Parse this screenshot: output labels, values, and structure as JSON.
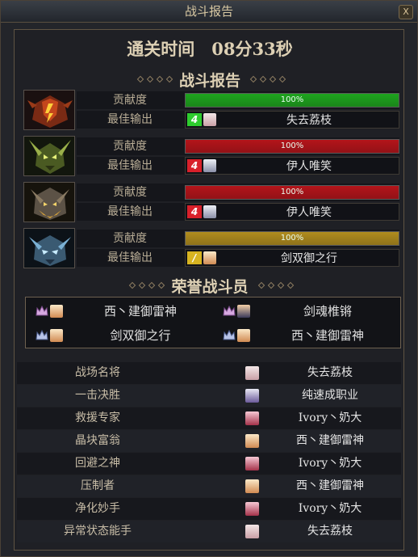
{
  "window": {
    "title": "战斗报告",
    "close_label": "X"
  },
  "clear_time": "通关时间　08分33秒",
  "battle_report": {
    "heading": "战斗报告",
    "contribution_label": "贡献度",
    "best_output_label": "最佳输出",
    "bosses": [
      {
        "icon": "red-demon-boss-icon",
        "contribution": "100%",
        "contribution_fraction": 1.0,
        "bar_color": "#1ea41e",
        "best_level_badge": "4",
        "badge_color": "#2ecc2e",
        "best_output_player": "失去荔枝"
      },
      {
        "icon": "green-horned-boss-icon",
        "contribution": "100%",
        "contribution_fraction": 1.0,
        "bar_color": "#b4141a",
        "best_level_badge": "4",
        "badge_color": "#d8202a",
        "best_output_player": "伊人唯笑"
      },
      {
        "icon": "gold-beast-boss-icon",
        "contribution": "100%",
        "contribution_fraction": 1.0,
        "bar_color": "#b4141a",
        "best_level_badge": "4",
        "badge_color": "#d8202a",
        "best_output_player": "伊人唯笑"
      },
      {
        "icon": "blue-ice-boss-icon",
        "contribution": "100%",
        "contribution_fraction": 1.0,
        "bar_color": "#b08c1e",
        "best_level_badge": "/",
        "badge_color": "#d8b421",
        "best_output_player": "剑双御之行"
      }
    ]
  },
  "honor": {
    "heading": "荣誉战斗员",
    "members": [
      {
        "name": "西丶建御雷神"
      },
      {
        "name": "剑魂椎锵"
      },
      {
        "name": "剑双御之行"
      },
      {
        "name": "西丶建御雷神"
      }
    ]
  },
  "awards": [
    {
      "title": "战场名将",
      "player": "失去荔枝"
    },
    {
      "title": "一击决胜",
      "player": "纯速成职业"
    },
    {
      "title": "救援专家",
      "player": "Ivory丶奶大"
    },
    {
      "title": "晶块富翁",
      "player": "西丶建御雷神"
    },
    {
      "title": "回避之神",
      "player": "Ivory丶奶大"
    },
    {
      "title": "压制者",
      "player": "西丶建御雷神"
    },
    {
      "title": "净化妙手",
      "player": "Ivory丶奶大"
    },
    {
      "title": "异常状态能手",
      "player": "失去荔枝"
    }
  ],
  "colors": {
    "panel_border": "#5f5443",
    "label_text": "#b9ad96",
    "heading_text": "#ddd0b4"
  }
}
